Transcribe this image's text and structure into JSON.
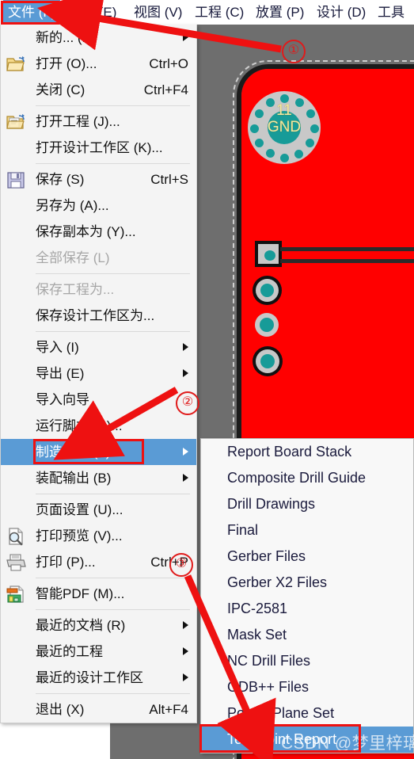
{
  "menubar": {
    "items": [
      {
        "label": "文件 (F)",
        "accel": "F",
        "selected": true
      },
      {
        "label": "编辑 (E)",
        "accel": "E",
        "selected": false
      },
      {
        "label": "视图 (V)",
        "accel": "V",
        "selected": false
      },
      {
        "label": "工程 (C)",
        "accel": "C",
        "selected": false
      },
      {
        "label": "放置 (P)",
        "accel": "P",
        "selected": false
      },
      {
        "label": "设计 (D)",
        "accel": "D",
        "selected": false
      },
      {
        "label": "工具",
        "accel": "",
        "selected": false
      }
    ]
  },
  "file_menu": {
    "items": [
      {
        "label": "新的... (N)",
        "shortcut": "",
        "icon": "",
        "submenu": true,
        "disabled": false,
        "highlighted": false
      },
      {
        "label": "打开 (O)...",
        "shortcut": "Ctrl+O",
        "icon": "open-folder-icon",
        "submenu": false,
        "disabled": false,
        "highlighted": false
      },
      {
        "label": "关闭 (C)",
        "shortcut": "Ctrl+F4",
        "icon": "",
        "submenu": false,
        "disabled": false,
        "highlighted": false
      },
      {
        "separator": true
      },
      {
        "label": "打开工程 (J)...",
        "shortcut": "",
        "icon": "open-project-icon",
        "submenu": false,
        "disabled": false,
        "highlighted": false
      },
      {
        "label": "打开设计工作区 (K)...",
        "shortcut": "",
        "icon": "",
        "submenu": false,
        "disabled": false,
        "highlighted": false
      },
      {
        "separator": true
      },
      {
        "label": "保存 (S)",
        "shortcut": "Ctrl+S",
        "icon": "save-icon",
        "submenu": false,
        "disabled": false,
        "highlighted": false
      },
      {
        "label": "另存为 (A)...",
        "shortcut": "",
        "icon": "",
        "submenu": false,
        "disabled": false,
        "highlighted": false
      },
      {
        "label": "保存副本为 (Y)...",
        "shortcut": "",
        "icon": "",
        "submenu": false,
        "disabled": false,
        "highlighted": false
      },
      {
        "label": "全部保存 (L)",
        "shortcut": "",
        "icon": "",
        "submenu": false,
        "disabled": true,
        "highlighted": false
      },
      {
        "separator": true
      },
      {
        "label": "保存工程为...",
        "shortcut": "",
        "icon": "",
        "submenu": false,
        "disabled": true,
        "highlighted": false
      },
      {
        "label": "保存设计工作区为...",
        "shortcut": "",
        "icon": "",
        "submenu": false,
        "disabled": false,
        "highlighted": false
      },
      {
        "separator": true
      },
      {
        "label": "导入 (I)",
        "shortcut": "",
        "icon": "",
        "submenu": true,
        "disabled": false,
        "highlighted": false
      },
      {
        "label": "导出 (E)",
        "shortcut": "",
        "icon": "",
        "submenu": true,
        "disabled": false,
        "highlighted": false
      },
      {
        "label": "导入向导",
        "shortcut": "",
        "icon": "",
        "submenu": false,
        "disabled": false,
        "highlighted": false
      },
      {
        "label": "运行脚本 (S)...",
        "shortcut": "",
        "icon": "",
        "submenu": false,
        "disabled": false,
        "highlighted": false
      },
      {
        "label": "制造输出 (F)",
        "shortcut": "",
        "icon": "",
        "submenu": true,
        "disabled": false,
        "highlighted": true
      },
      {
        "label": "装配输出 (B)",
        "shortcut": "",
        "icon": "",
        "submenu": true,
        "disabled": false,
        "highlighted": false
      },
      {
        "separator": true
      },
      {
        "label": "页面设置 (U)...",
        "shortcut": "",
        "icon": "",
        "submenu": false,
        "disabled": false,
        "highlighted": false
      },
      {
        "label": "打印预览 (V)...",
        "shortcut": "",
        "icon": "print-preview-icon",
        "submenu": false,
        "disabled": false,
        "highlighted": false
      },
      {
        "label": "打印 (P)...",
        "shortcut": "Ctrl+P",
        "icon": "printer-icon",
        "submenu": false,
        "disabled": false,
        "highlighted": false
      },
      {
        "separator": true
      },
      {
        "label": "智能PDF (M)...",
        "shortcut": "",
        "icon": "smart-pdf-icon",
        "submenu": false,
        "disabled": false,
        "highlighted": false
      },
      {
        "separator": true
      },
      {
        "label": "最近的文档 (R)",
        "shortcut": "",
        "icon": "",
        "submenu": true,
        "disabled": false,
        "highlighted": false
      },
      {
        "label": "最近的工程",
        "shortcut": "",
        "icon": "",
        "submenu": true,
        "disabled": false,
        "highlighted": false
      },
      {
        "label": "最近的设计工作区",
        "shortcut": "",
        "icon": "",
        "submenu": true,
        "disabled": false,
        "highlighted": false
      },
      {
        "separator": true
      },
      {
        "label": "退出 (X)",
        "shortcut": "Alt+F4",
        "icon": "",
        "submenu": false,
        "disabled": false,
        "highlighted": false
      }
    ]
  },
  "fabrication_submenu": {
    "items": [
      {
        "label": "Report Board Stack",
        "highlighted": false
      },
      {
        "label": "Composite Drill Guide",
        "highlighted": false
      },
      {
        "label": "Drill Drawings",
        "highlighted": false
      },
      {
        "label": "Final",
        "highlighted": false
      },
      {
        "label": "Gerber Files",
        "highlighted": false
      },
      {
        "label": "Gerber X2 Files",
        "highlighted": false
      },
      {
        "label": "IPC-2581",
        "highlighted": false
      },
      {
        "label": "Mask Set",
        "highlighted": false
      },
      {
        "label": "NC Drill Files",
        "highlighted": false
      },
      {
        "label": "ODB++ Files",
        "highlighted": false
      },
      {
        "label": "Power-Plane Set",
        "highlighted": false
      },
      {
        "label": "Test Point Report",
        "highlighted": true
      }
    ]
  },
  "annotations": {
    "step1": "①",
    "step2": "②",
    "step3": "③"
  },
  "pcb": {
    "via_number": "11",
    "via_net": "GND",
    "board_color": "#ff0000",
    "pad_color": "#c8c8c8",
    "copper_color": "#179b98",
    "label_color": "#f4e8a0",
    "canvas_color": "#6e6e6e"
  },
  "watermark": {
    "text": "CSDN @梦里梓璃"
  },
  "colors": {
    "highlight": "#5a9bd5",
    "annotation_red": "#ee1111",
    "menu_bg": "#f4f4f4"
  }
}
